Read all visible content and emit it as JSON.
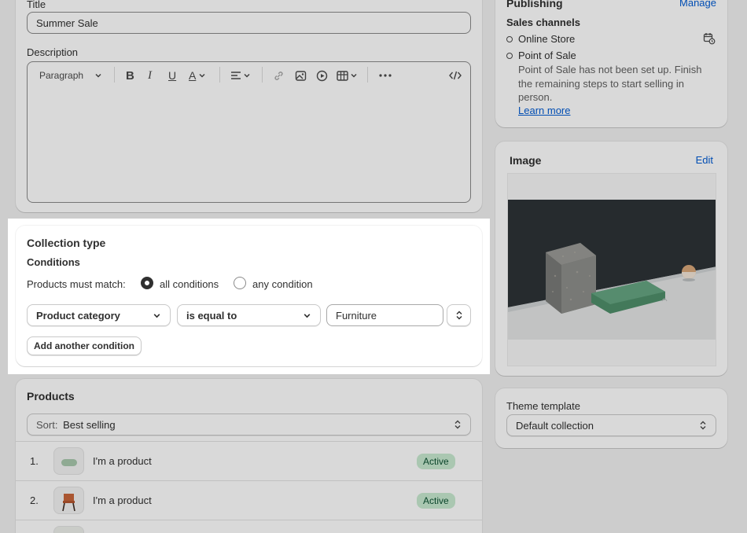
{
  "main": {
    "title_label": "Title",
    "title_value": "Summer Sale",
    "description_label": "Description",
    "toolbar": {
      "paragraph_label": "Paragraph"
    }
  },
  "collection_type": {
    "heading": "Collection type",
    "conditions_label": "Conditions",
    "match_label": "Products must match:",
    "option_all": "all conditions",
    "option_any": "any condition",
    "selected_option": "all conditions",
    "condition": {
      "field": "Product category",
      "operator": "is equal to",
      "value": "Furniture"
    },
    "add_button": "Add another condition"
  },
  "products": {
    "heading": "Products",
    "sort_prefix": "Sort:",
    "sort_value": "Best selling",
    "items": [
      {
        "index": "1.",
        "name": "I'm a product",
        "status": "Active"
      },
      {
        "index": "2.",
        "name": "I'm a product",
        "status": "Active"
      }
    ]
  },
  "publishing": {
    "heading": "Publishing",
    "manage_link": "Manage",
    "channels_label": "Sales channels",
    "online_store": "Online Store",
    "pos": "Point of Sale",
    "pos_note": "Point of Sale has not been set up. Finish the remaining steps to start selling in person.",
    "learn_more": "Learn more"
  },
  "image_card": {
    "heading": "Image",
    "edit_link": "Edit"
  },
  "theme_template": {
    "label": "Theme template",
    "value": "Default collection"
  },
  "colors": {
    "accent": "#005bd3",
    "badge_bg": "#c8ead0",
    "badge_text": "#0c5132",
    "page_bg": "#f1f1f1"
  }
}
